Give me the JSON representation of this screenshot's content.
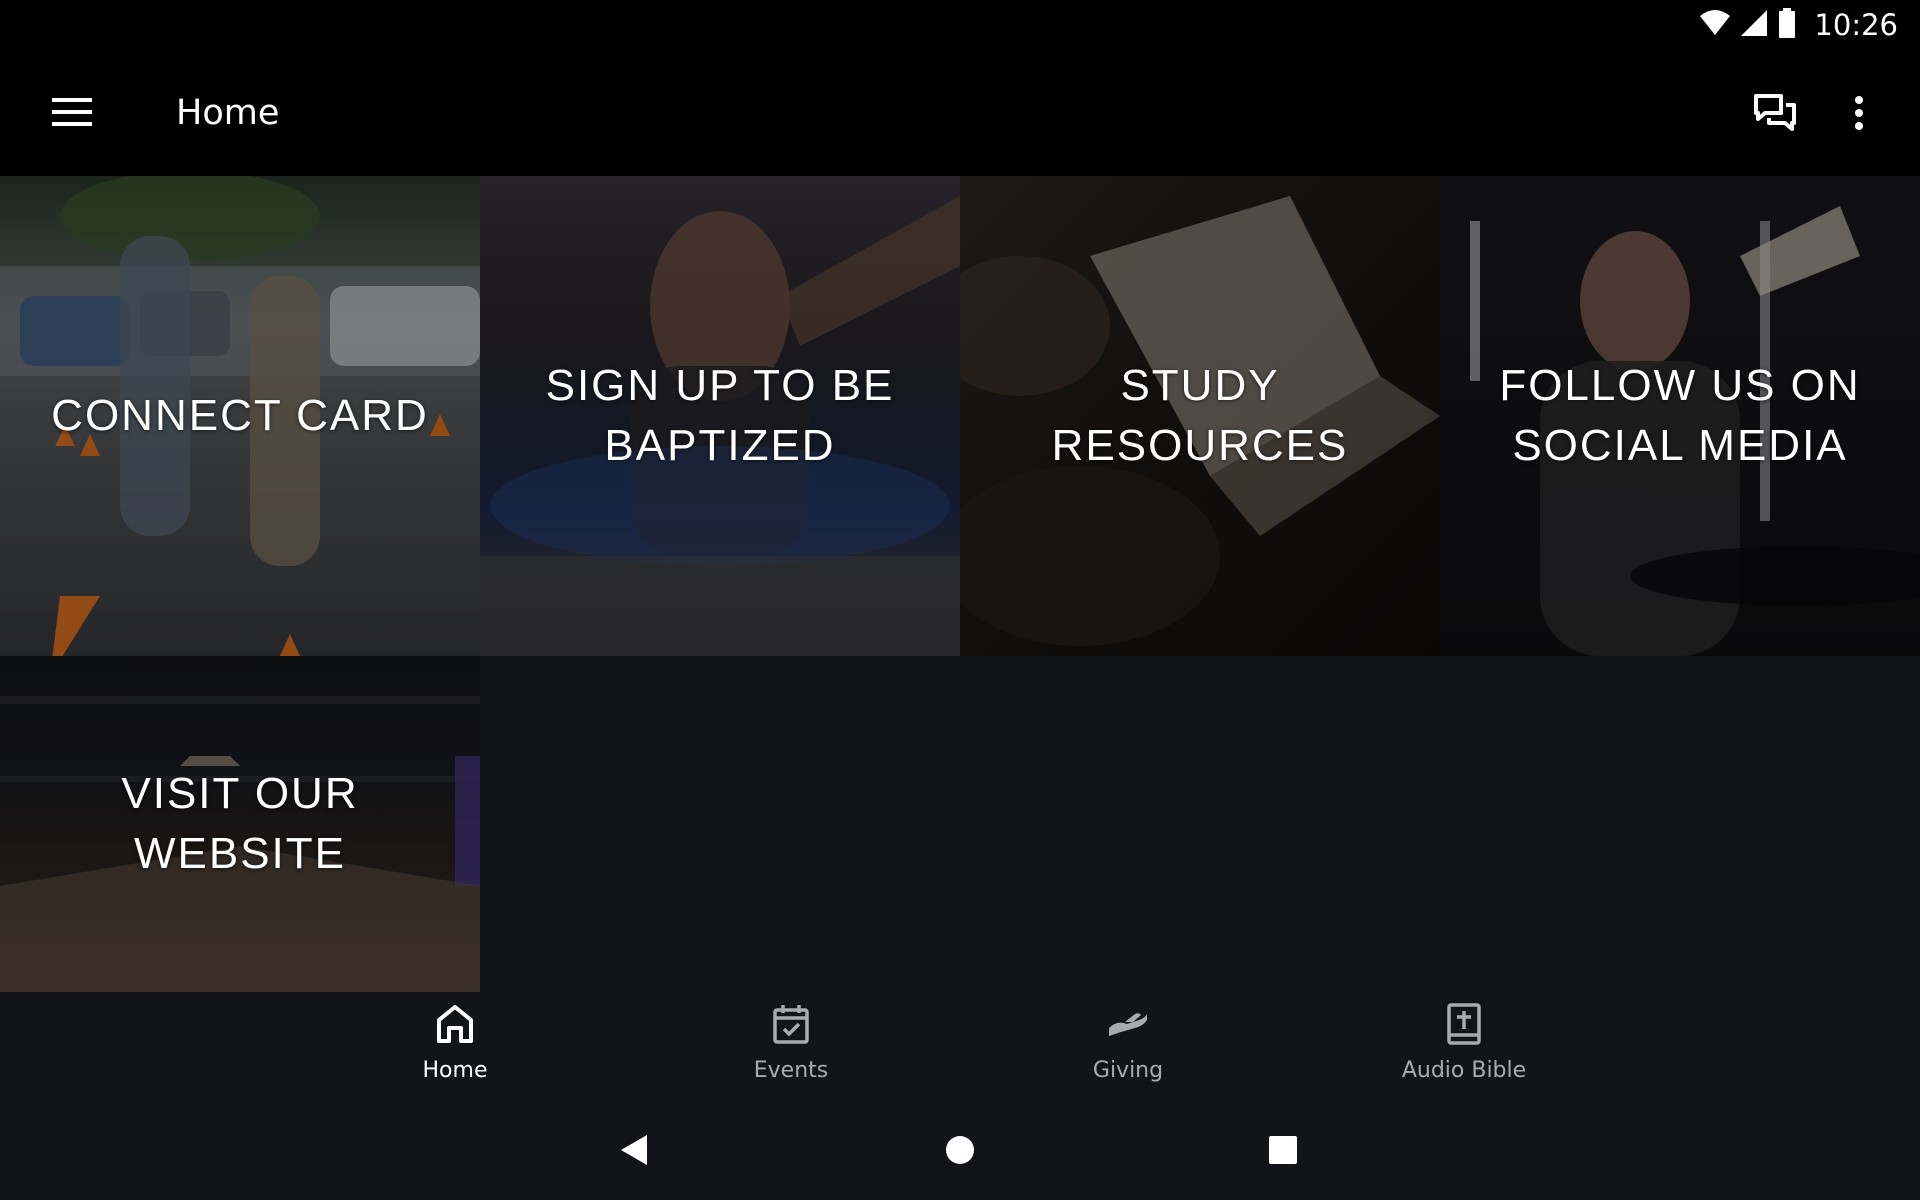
{
  "status_bar": {
    "time": "10:26",
    "icons": [
      "wifi-icon",
      "cell-signal-icon",
      "battery-icon"
    ]
  },
  "app_bar": {
    "title": "Home",
    "icons": [
      "menu-icon",
      "chat-icon",
      "more-vert-icon"
    ]
  },
  "tiles": [
    {
      "label": "CONNECT CARD"
    },
    {
      "label": "SIGN UP TO BE BAPTIZED"
    },
    {
      "label": "STUDY RESOURCES"
    },
    {
      "label": "FOLLOW US ON SOCIAL MEDIA"
    },
    {
      "label": "VISIT OUR WEBSITE"
    }
  ],
  "bottom_nav": {
    "items": [
      {
        "label": "Home",
        "icon": "home-icon",
        "active": true
      },
      {
        "label": "Events",
        "icon": "calendar-check-icon",
        "active": false
      },
      {
        "label": "Giving",
        "icon": "giving-hand-icon",
        "active": false
      },
      {
        "label": "Audio Bible",
        "icon": "bible-icon",
        "active": false
      }
    ]
  },
  "system_nav": {
    "icons": [
      "back-icon",
      "home-circle-icon",
      "recents-icon"
    ]
  },
  "colors": {
    "background": "#131417",
    "app_bar": "#000000",
    "nav_inactive": "#a9abae",
    "nav_active": "#ffffff"
  }
}
